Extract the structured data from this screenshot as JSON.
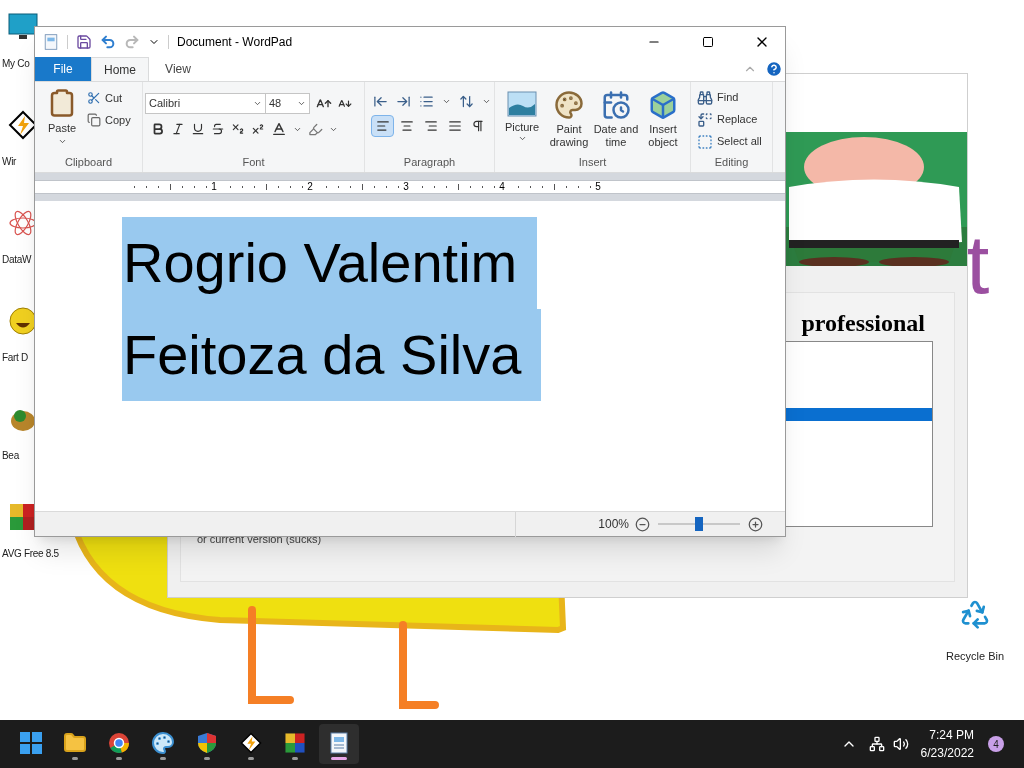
{
  "desktop": {
    "icons": [
      {
        "label": "My Co",
        "kind": "monitor"
      },
      {
        "label": "Wir",
        "kind": "winamp"
      },
      {
        "label": "DataW",
        "kind": "atom"
      },
      {
        "label": "Fart D",
        "kind": "smiley"
      },
      {
        "label": "Bea",
        "kind": "bug"
      },
      {
        "label": "AVG Free 8.5",
        "kind": "avg"
      }
    ],
    "recycle_bin": {
      "label": "Recycle Bin"
    },
    "wallpaper_text": "t"
  },
  "background_window": {
    "heading": "professional",
    "list": {
      "rows": [
        {
          "selected": false
        },
        {
          "selected": false
        },
        {
          "selected": false
        },
        {
          "selected": false
        },
        {
          "selected": false
        },
        {
          "selected": true
        },
        {
          "selected": false
        },
        {
          "selected": false
        },
        {
          "selected": false
        },
        {
          "selected": false
        },
        {
          "selected": false
        },
        {
          "selected": false
        },
        {
          "selected": false
        },
        {
          "selected": false
        }
      ]
    },
    "footer_text": "or current version (sucks)"
  },
  "wordpad": {
    "title": "Document - WordPad",
    "quick_access": [
      {
        "kind": "save",
        "disabled": false
      },
      {
        "kind": "undo",
        "disabled": false
      },
      {
        "kind": "redo",
        "disabled": true
      }
    ],
    "tabs": [
      {
        "label": "File",
        "kind": "file",
        "selected": false
      },
      {
        "label": "Home",
        "kind": "tab",
        "selected": true
      },
      {
        "label": "View",
        "kind": "tab",
        "selected": false
      }
    ],
    "ribbon": {
      "clipboard": {
        "label": "Clipboard",
        "paste": "Paste",
        "cut": "Cut",
        "copy": "Copy"
      },
      "font": {
        "label": "Font",
        "font_name": "Calibri",
        "font_size": "48"
      },
      "paragraph": {
        "label": "Paragraph",
        "alignment": [
          {
            "kind": "left",
            "selected": true
          },
          {
            "kind": "center",
            "selected": false
          },
          {
            "kind": "right",
            "selected": false
          },
          {
            "kind": "justify",
            "selected": false
          }
        ]
      },
      "insert": {
        "label": "Insert",
        "items": [
          {
            "kind": "picture",
            "label": "Picture"
          },
          {
            "kind": "paint",
            "label": "Paint drawing"
          },
          {
            "kind": "datetime",
            "label": "Date and time"
          },
          {
            "kind": "object",
            "label": "Insert object"
          }
        ]
      },
      "editing": {
        "label": "Editing",
        "items": [
          {
            "kind": "find",
            "label": "Find"
          },
          {
            "kind": "replace",
            "label": "Replace"
          },
          {
            "kind": "select",
            "label": "Select all"
          }
        ]
      }
    },
    "ruler": {
      "numbers": [
        "1",
        "2",
        "3",
        "4",
        "5"
      ]
    },
    "document": {
      "lines": [
        {
          "text": "Rogrio Valentim",
          "selected": true
        },
        {
          "text": "Feitoza da Silva",
          "selected": true
        }
      ]
    },
    "status_bar": {
      "zoom": "100%",
      "zoom_slider": {
        "level": 0.5
      }
    }
  },
  "taskbar": {
    "apps": [
      {
        "kind": "start",
        "running": false,
        "active": false
      },
      {
        "kind": "folder",
        "running": true,
        "active": false
      },
      {
        "kind": "chrome",
        "running": true,
        "active": false
      },
      {
        "kind": "paint",
        "running": true,
        "active": false
      },
      {
        "kind": "shield",
        "running": true,
        "active": false
      },
      {
        "kind": "winamp",
        "running": true,
        "active": false
      },
      {
        "kind": "avg",
        "running": true,
        "active": false
      },
      {
        "kind": "wordpad",
        "running": true,
        "active": true
      }
    ],
    "clock": {
      "time": "7:24 PM",
      "date": "6/23/2022"
    },
    "notification_count": "4"
  }
}
